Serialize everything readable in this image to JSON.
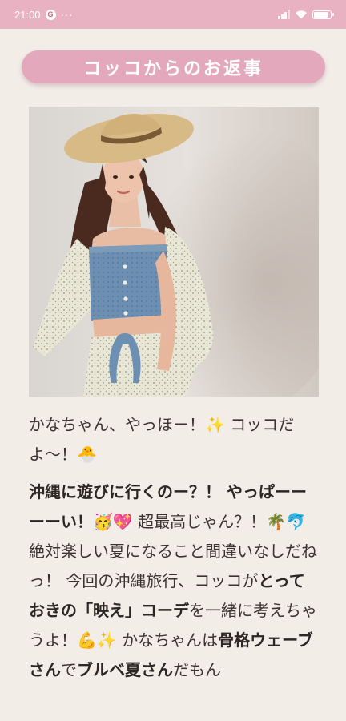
{
  "status_bar": {
    "time": "21:00",
    "google_badge": "G",
    "more_dots": "···"
  },
  "header": {
    "title": "コッコからのお返事"
  },
  "image": {
    "subject": "woman-in-straw-hat-and-denim-top"
  },
  "message": {
    "p1": "かなちゃん、やっほー！✨ コッコだよ〜！🐣",
    "p2_a": "沖縄に遊びに行くのー？！ やっぱーーーーい！",
    "p2_b": "🥳💖 超最高じゃん？！🌴🐬 絶対楽しい夏になること間違いなしだねっ！ 今回の沖縄旅行、コッコが",
    "p2_c": "とっておきの「映え」コーデ",
    "p2_d": "を一緒に考えちゃうよ！💪✨ かなちゃんは",
    "p2_e": "骨格ウェーブさん",
    "p2_f": "で",
    "p2_g": "ブルベ夏さん",
    "p2_h": "だもん"
  },
  "colors": {
    "status_bar": "#e8b2c3",
    "title_pill": "#e4a8bd",
    "background": "#f3ede8",
    "text": "#3a3332"
  }
}
